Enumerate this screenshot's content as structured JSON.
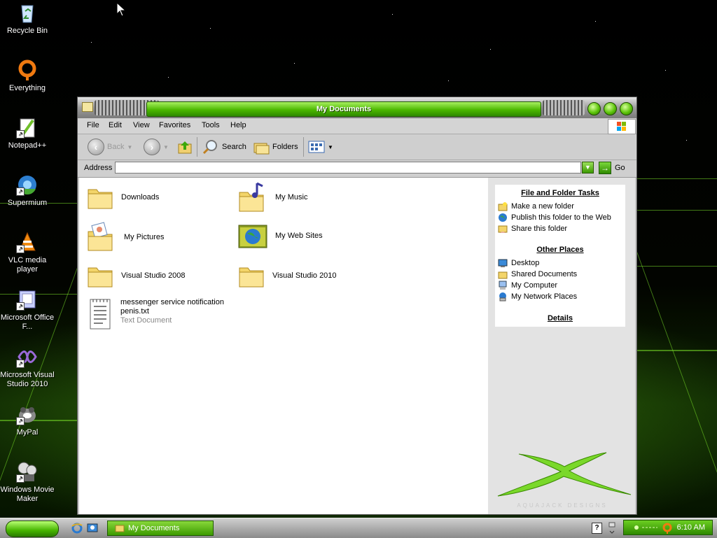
{
  "desktop": {
    "icons": [
      {
        "label": "Recycle Bin",
        "icon": "recycle-bin-icon"
      },
      {
        "label": "Everything",
        "icon": "everything-icon"
      },
      {
        "label": "Notepad++",
        "icon": "notepadpp-icon"
      },
      {
        "label": "Supermium",
        "icon": "supermium-icon"
      },
      {
        "label": "VLC media player",
        "icon": "vlc-icon"
      },
      {
        "label": "Microsoft Office F...",
        "icon": "office-icon"
      },
      {
        "label": "Microsoft Visual Studio 2010",
        "icon": "visual-studio-icon"
      },
      {
        "label": "MyPal",
        "icon": "mypal-icon"
      },
      {
        "label": "Windows Movie Maker",
        "icon": "movie-maker-icon"
      }
    ]
  },
  "window": {
    "title": "My Documents",
    "menu": [
      "File",
      "Edit",
      "View",
      "Favorites",
      "Tools",
      "Help"
    ],
    "toolbar": {
      "back": "Back",
      "search": "Search",
      "folders": "Folders"
    },
    "address": {
      "label": "Address",
      "value": "",
      "go": "Go"
    },
    "items": [
      {
        "name": "Downloads",
        "icon": "folder-icon"
      },
      {
        "name": "My Music",
        "icon": "music-folder-icon"
      },
      {
        "name": "My Pictures",
        "icon": "pictures-folder-icon"
      },
      {
        "name": "My Web Sites",
        "icon": "web-sites-folder-icon"
      },
      {
        "name": "Visual Studio 2008",
        "icon": "folder-icon"
      },
      {
        "name": "Visual Studio 2010",
        "icon": "folder-icon"
      },
      {
        "name": "messenger service notification penis.txt",
        "type": "Text Document",
        "icon": "text-document-icon"
      }
    ],
    "taskpane": {
      "file_tasks": {
        "title": "File and Folder Tasks",
        "items": [
          "Make a new folder",
          "Publish this folder to the Web",
          "Share this folder"
        ]
      },
      "other_places": {
        "title": "Other Places",
        "items": [
          "Desktop",
          "Shared Documents",
          "My Computer",
          "My Network Places"
        ]
      },
      "details": {
        "title": "Details"
      }
    },
    "brand_text": "AQUAJACK DESIGNS"
  },
  "taskbar": {
    "active_task": "My Documents",
    "clock": "6:10 AM",
    "accent": "#4cb800"
  }
}
